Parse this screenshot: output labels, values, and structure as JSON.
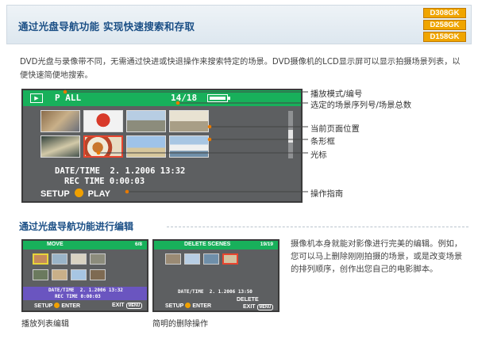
{
  "header": {
    "title": "通过光盘导航功能  实现快速搜索和存取",
    "models": [
      "D308GK",
      "D258GK",
      "D158GK"
    ]
  },
  "intro": "DVD光盘与录像带不同，无需通过快进或快退操作来搜索特定的场景。DVD摄像机的LCD显示屏可以显示拍摄场景列表，以便快速简便地搜索。",
  "lcd": {
    "mode_icon": "▶",
    "mode_text": "P ALL",
    "count_text": "14/18",
    "date_time": "DATE/TIME  2. 1.2006 13:32",
    "rec_time": "REC TIME 0:00:03",
    "guide_setup": "SETUP",
    "guide_play": "PLAY",
    "colors": {
      "bar": "#18b05b",
      "cursor": "#e8452f",
      "screen": "#5d5f61"
    }
  },
  "callouts": {
    "mode": "播放模式/编号",
    "selected": "选定的场景序列号/场景总数",
    "page_pos": "当前页面位置",
    "bar": "条形框",
    "cursor": "光标",
    "guide": "操作指南"
  },
  "section2": {
    "title": "通过光盘导航功能进行编辑",
    "text": "摄像机本身就能对影像进行完美的编辑。例如，您可以马上删除刚刚拍摄的场景，或是改变场景的排列顺序，创作出您自己的电影脚本。",
    "screen1": {
      "label": "MOVE",
      "count": "6/8",
      "date_time": "DATE/TIME  2. 1.2006 13:32",
      "rec_time": "REC TIME 0:00:03",
      "setup": "SETUP",
      "enter": "ENTER",
      "exit": "EXIT",
      "menu": "MENU",
      "caption": "播放列表编辑"
    },
    "screen2": {
      "label": "DELETE SCENES",
      "count": "19/19",
      "date_time": "DATE/TIME  2. 1.2006 13:50",
      "delete": "DELETE",
      "setup": "SETUP",
      "enter": "ENTER",
      "exit": "EXIT",
      "menu": "MENU",
      "caption": "简明的删除操作"
    }
  }
}
